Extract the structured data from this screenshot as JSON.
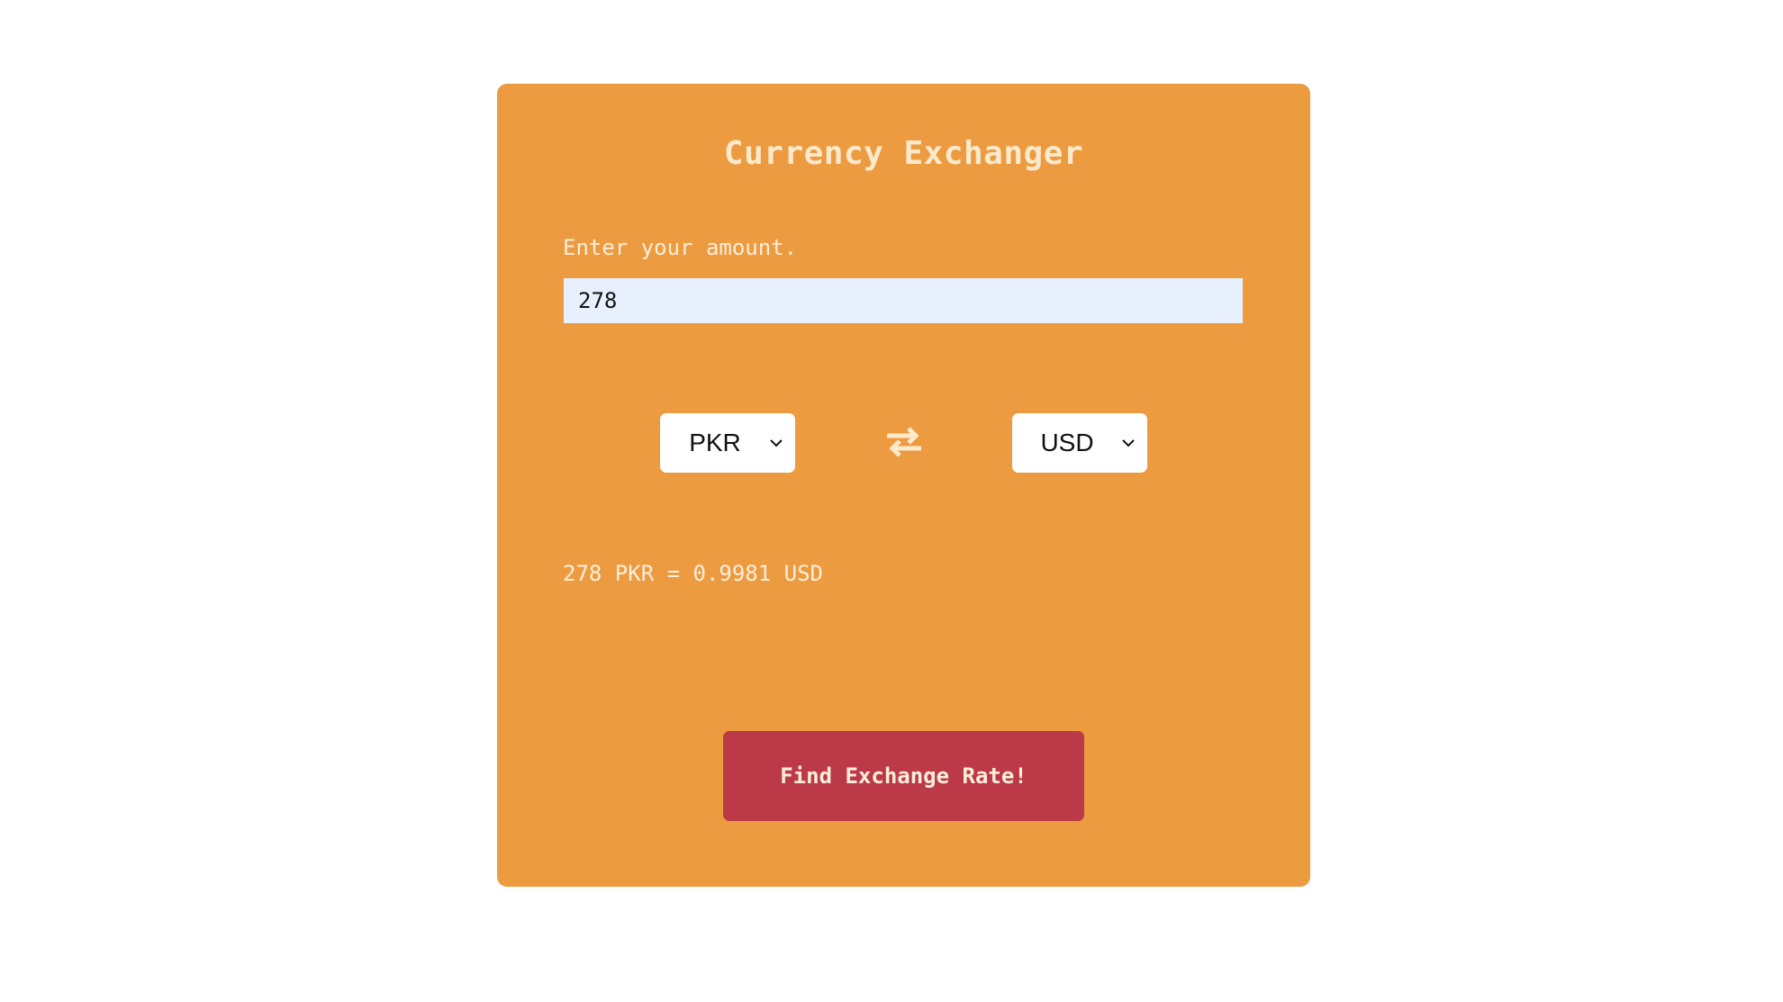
{
  "app": {
    "title": "Currency Exchanger"
  },
  "amount": {
    "label": "Enter your amount.",
    "value": "278"
  },
  "currency": {
    "from": "PKR",
    "to": "USD"
  },
  "icons": {
    "swap": "swap-arrows-icon",
    "dropdown": "chevron-down-icon"
  },
  "result": {
    "text": "278 PKR = 0.9981 USD"
  },
  "actions": {
    "find_label": "Find Exchange Rate!"
  },
  "colors": {
    "card_background": "#ec9b40",
    "button_background": "#bc3a47",
    "input_background": "#e8f0fe",
    "text_light": "#fdeedb"
  }
}
